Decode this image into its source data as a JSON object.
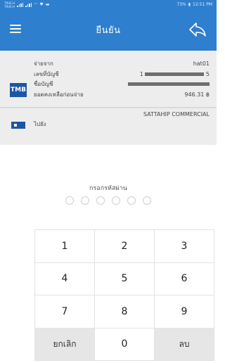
{
  "status_bar": {
    "carrier_top": "TRUE-H",
    "carrier_bottom": "TRUE-H",
    "battery": "73%",
    "time": "12:51 PM"
  },
  "header": {
    "title": "ยืนยัน",
    "menu_icon": "hamburger-menu-icon",
    "back_icon": "back-arrow-icon"
  },
  "confirm": {
    "bank_logo": "TMB",
    "labels": [
      "จ่ายจาก",
      "เลขที่บัญชี",
      "ชื่อบัญชี",
      "ยอดคงเหลือก่อนจ่าย"
    ],
    "from_value": "hat01",
    "account_no": "1",
    "account_no_tail": "5",
    "balance": "946.31 ฿",
    "to_label": "ไปยัง",
    "to_bank": "SATTAHIP COMMERCIAL"
  },
  "pin": {
    "label": "กรอกรหัสผ่าน",
    "length": 6
  },
  "keypad": {
    "keys": [
      "1",
      "2",
      "3",
      "4",
      "5",
      "6",
      "7",
      "8",
      "9",
      "ยกเลิก",
      "0",
      "ลบ"
    ],
    "colors": {
      "key_bg": "#ffffff",
      "fn_bg": "#e6e6e6",
      "accent": "#2f7fcf"
    }
  }
}
